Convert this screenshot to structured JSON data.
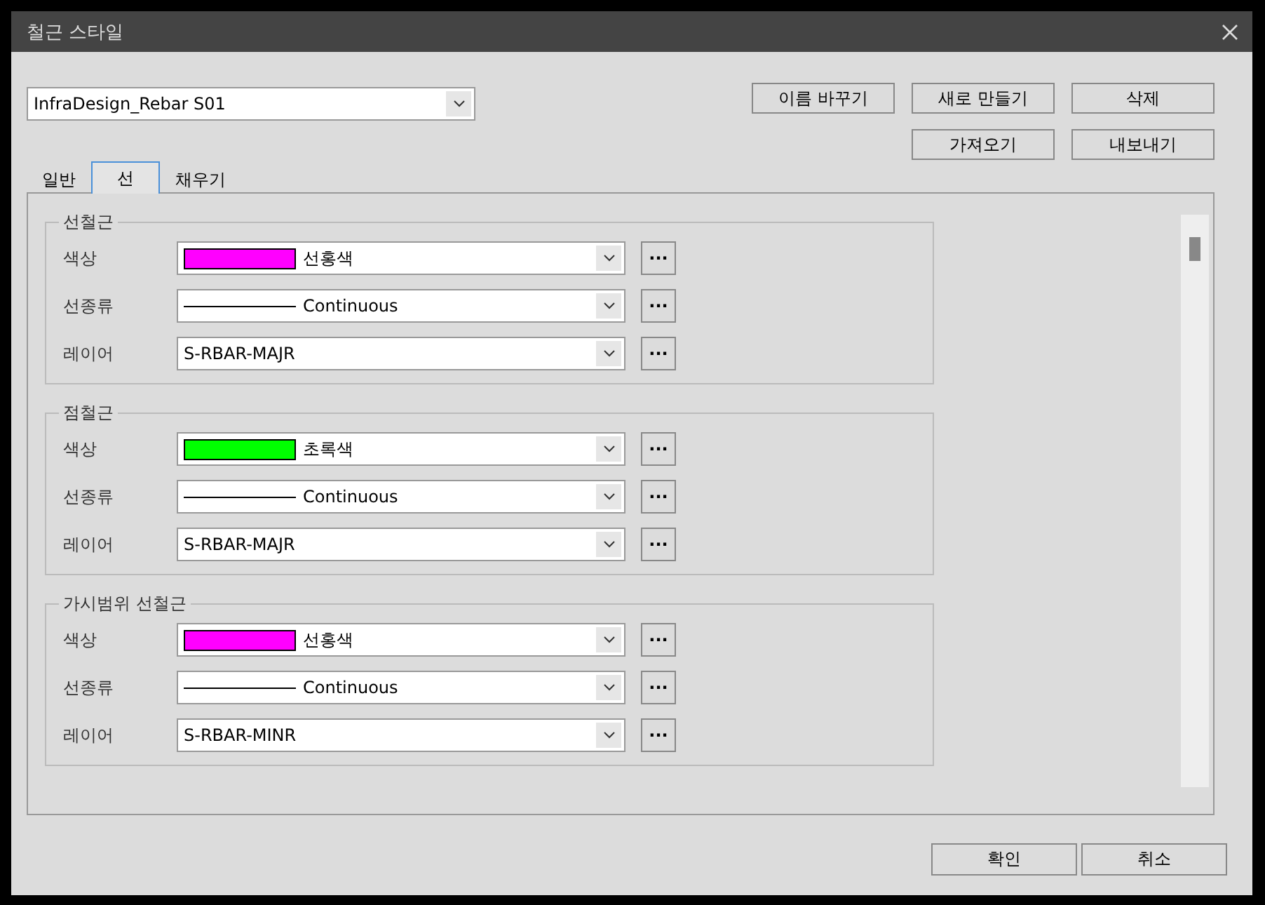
{
  "window": {
    "title": "철근 스타일"
  },
  "style_select": {
    "value": "InfraDesign_Rebar S01"
  },
  "actions": [
    {
      "label": "이름 바꾸기"
    },
    {
      "label": "새로 만들기"
    },
    {
      "label": "삭제"
    },
    {
      "label": "가져오기"
    },
    {
      "label": "내보내기"
    }
  ],
  "tabs": [
    {
      "label": "일반",
      "selected": false
    },
    {
      "label": "선",
      "selected": true
    },
    {
      "label": "채우기",
      "selected": false
    }
  ],
  "groups": [
    {
      "title": "선철근",
      "rows": [
        {
          "kind": "color",
          "label": "색상",
          "value": "선홍색",
          "color": "#ff00ff"
        },
        {
          "kind": "linetype",
          "label": "선종류",
          "value": "Continuous"
        },
        {
          "kind": "layer",
          "label": "레이어",
          "value": "S-RBAR-MAJR"
        }
      ]
    },
    {
      "title": "점철근",
      "rows": [
        {
          "kind": "color",
          "label": "색상",
          "value": "초록색",
          "color": "#00ff00"
        },
        {
          "kind": "linetype",
          "label": "선종류",
          "value": "Continuous"
        },
        {
          "kind": "layer",
          "label": "레이어",
          "value": "S-RBAR-MAJR"
        }
      ]
    },
    {
      "title": "가시범위 선철근",
      "rows": [
        {
          "kind": "color",
          "label": "색상",
          "value": "선홍색",
          "color": "#ff00ff"
        },
        {
          "kind": "linetype",
          "label": "선종류",
          "value": "Continuous"
        },
        {
          "kind": "layer",
          "label": "레이어",
          "value": "S-RBAR-MINR"
        }
      ]
    }
  ],
  "browse_button": {
    "label": "..."
  },
  "footer_buttons": [
    {
      "label": "확인"
    },
    {
      "label": "취소"
    }
  ]
}
